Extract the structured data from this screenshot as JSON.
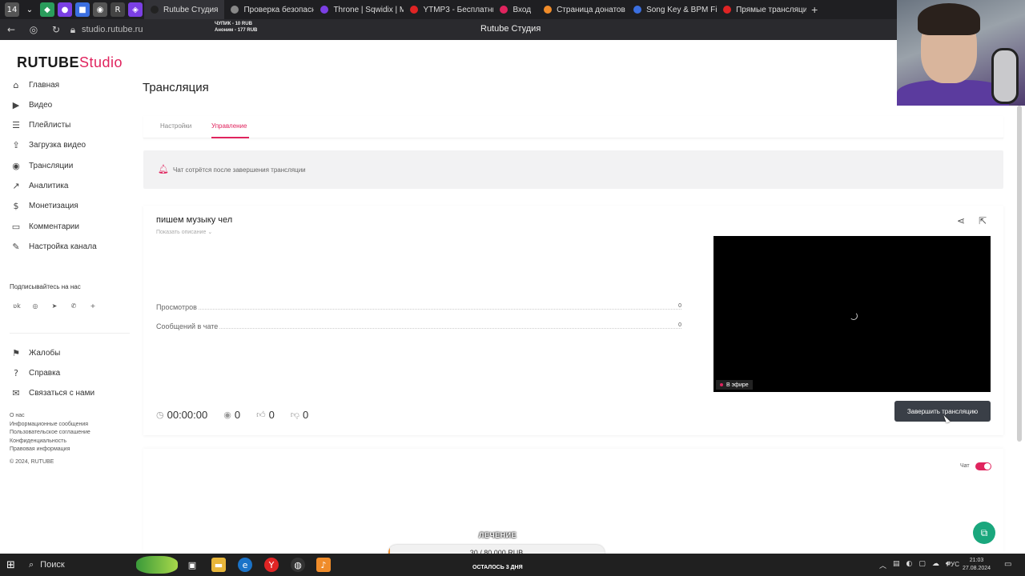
{
  "browser": {
    "tabs": [
      {
        "label": "Rutube Студия",
        "active": true,
        "color": "#222222"
      },
      {
        "label": "Проверка безопасн",
        "color": "#888888"
      },
      {
        "label": "Throne | Sqwidix | M",
        "color": "#7b3fe4"
      },
      {
        "label": "YTMP3 - Бесплатны",
        "color": "#e02424"
      },
      {
        "label": "Вход",
        "color": "#e0245e"
      },
      {
        "label": "Страница донатов",
        "color": "#f08c2a"
      },
      {
        "label": "Song Key & BPM Fin",
        "color": "#3b6fe0"
      },
      {
        "label": "Прямые трансляци",
        "color": "#e02424"
      }
    ],
    "url": "studio.rutube.ru",
    "page_title": "Rutube Студия",
    "mini_donate_line1": "ЧУПИК - 10 RUB",
    "mini_donate_line2": "Аноним - 177 RUB"
  },
  "sidebar": {
    "logo_main": "RUTUBE",
    "logo_sub": "Studio",
    "items": [
      {
        "label": "Главная",
        "icon": "home-icon"
      },
      {
        "label": "Видео",
        "icon": "video-icon"
      },
      {
        "label": "Плейлисты",
        "icon": "playlist-icon"
      },
      {
        "label": "Загрузка видео",
        "icon": "upload-icon"
      },
      {
        "label": "Трансляции",
        "icon": "broadcast-icon"
      },
      {
        "label": "Аналитика",
        "icon": "analytics-icon"
      },
      {
        "label": "Монетизация",
        "icon": "monetization-icon"
      },
      {
        "label": "Комментарии",
        "icon": "comments-icon"
      },
      {
        "label": "Настройка канала",
        "icon": "settings-icon"
      }
    ],
    "subscribe_title": "Подписывайтесь на нас",
    "secondary": [
      {
        "label": "Жалобы",
        "icon": "flag-icon"
      },
      {
        "label": "Справка",
        "icon": "help-icon"
      },
      {
        "label": "Связаться с нами",
        "icon": "mail-icon"
      }
    ],
    "footer": [
      "О нас",
      "Информационные сообщения",
      "Пользовательское соглашение",
      "Конфиденциальность",
      "Правовая информация",
      "© 2024, RUTUBE"
    ]
  },
  "main": {
    "title": "Трансляция",
    "tabs": [
      {
        "label": "Настройки"
      },
      {
        "label": "Управление",
        "active": true
      }
    ],
    "notice": "Чат сотрётся после завершения трансляции",
    "stream": {
      "title": "пишем музыку чел",
      "show_description": "Показать описание",
      "stats": [
        {
          "label": "Просмотров",
          "value": "0"
        },
        {
          "label": "Сообщений в чате",
          "value": "0"
        }
      ],
      "live_badge": "В эфире",
      "duration": "00:00:00",
      "viewers": "0",
      "likes": "0",
      "dislikes": "0",
      "end_button": "Завершить трансляцию"
    },
    "chat_label": "Чат",
    "chat_enabled": true
  },
  "donation": {
    "label": "ЛЕЧЕНИЕ",
    "amount": "30 / 80 000 RUB",
    "remaining": "ОСТАЛОСЬ 3 ДНЯ",
    "progress": 0.000375
  },
  "taskbar": {
    "search": "Поиск",
    "lang": "РУС",
    "time": "21:03",
    "date": "27.08.2024"
  },
  "colors": {
    "accent": "#e0245e",
    "live": "#e0245e",
    "button_dark": "#3a3f47",
    "help": "#1aa77d"
  }
}
